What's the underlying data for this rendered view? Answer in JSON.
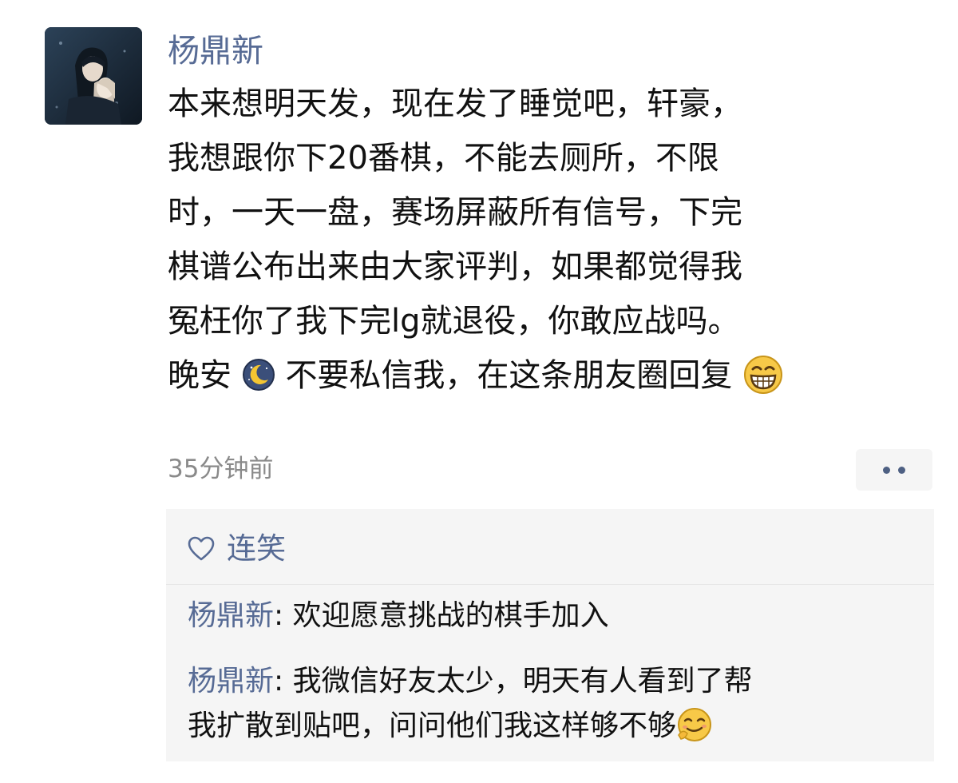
{
  "post": {
    "author": "杨鼎新",
    "avatar_icon": "anime-character-avatar-icon",
    "lines": [
      "本来想明天发，现在发了睡觉吧，轩豪，",
      "我想跟你下20番棋，不能去厕所，不限",
      "时，一天一盘，赛场屏蔽所有信号，下完",
      "棋谱公布出来由大家评判，如果都觉得我",
      "冤枉你了我下完lg就退役，你敢应战吗。"
    ],
    "last_line": {
      "part1": "晚安",
      "emoji1": "moon-sleep-emoji",
      "part2": " 不要私信我，在这条朋友圈回复",
      "emoji2": "grin-emoji"
    },
    "timestamp": "35分钟前",
    "more_icon": "more-dots-icon"
  },
  "likes": {
    "icon": "heart-outline-icon",
    "names": "连笑"
  },
  "comments": [
    {
      "author": "杨鼎新",
      "separator": ": ",
      "line1": "欢迎愿意挑战的棋手加入",
      "line2": ""
    },
    {
      "author": "杨鼎新",
      "separator": ": ",
      "line1": "我微信好友太少，明天有人看到了帮",
      "line2": "我扩散到贴吧，问问他们我这样够不够",
      "emoji": "blush-smile-emoji"
    }
  ],
  "colors": {
    "link": "#576b95",
    "text": "#111111",
    "meta": "#8a8a8a",
    "panel": "#f5f5f5"
  }
}
